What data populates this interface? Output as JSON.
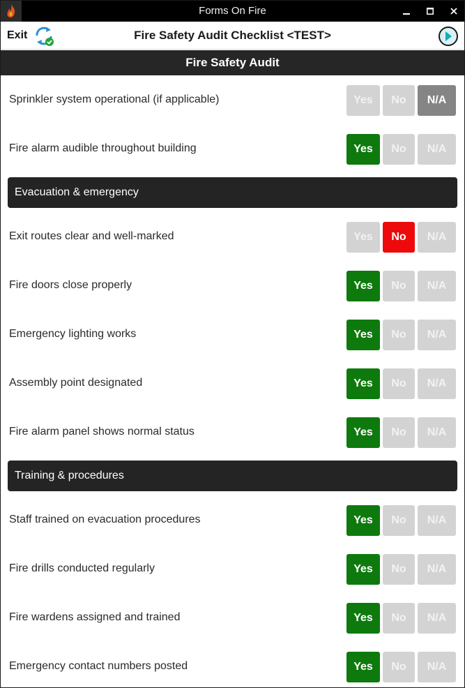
{
  "window": {
    "title": "Forms On Fire"
  },
  "header": {
    "exit_label": "Exit",
    "form_title": "Fire Safety Audit Checklist <TEST>"
  },
  "page": {
    "title": "Fire Safety Audit"
  },
  "option_labels": {
    "yes": "Yes",
    "no": "No",
    "na": "N/A"
  },
  "colors": {
    "yes_selected": "#0e7a0d",
    "no_selected": "#ee0a0a",
    "na_selected": "#858585",
    "unselected": "#d3d3d3",
    "section_bar": "#242424"
  },
  "items": [
    {
      "kind": "question",
      "label": "Sprinkler system operational (if applicable)",
      "selected": "na"
    },
    {
      "kind": "question",
      "label": "Fire alarm audible throughout building",
      "selected": "yes"
    },
    {
      "kind": "section",
      "label": "Evacuation & emergency"
    },
    {
      "kind": "question",
      "label": "Exit routes clear and well-marked",
      "selected": "no"
    },
    {
      "kind": "question",
      "label": "Fire doors close properly",
      "selected": "yes"
    },
    {
      "kind": "question",
      "label": "Emergency lighting works",
      "selected": "yes"
    },
    {
      "kind": "question",
      "label": "Assembly point designated",
      "selected": "yes"
    },
    {
      "kind": "question",
      "label": "Fire alarm panel shows normal status",
      "selected": "yes"
    },
    {
      "kind": "section",
      "label": "Training & procedures"
    },
    {
      "kind": "question",
      "label": "Staff trained on evacuation procedures",
      "selected": "yes"
    },
    {
      "kind": "question",
      "label": "Fire drills conducted regularly",
      "selected": "yes"
    },
    {
      "kind": "question",
      "label": "Fire wardens assigned and trained",
      "selected": "yes"
    },
    {
      "kind": "question",
      "label": "Emergency contact numbers posted",
      "selected": "yes"
    }
  ]
}
